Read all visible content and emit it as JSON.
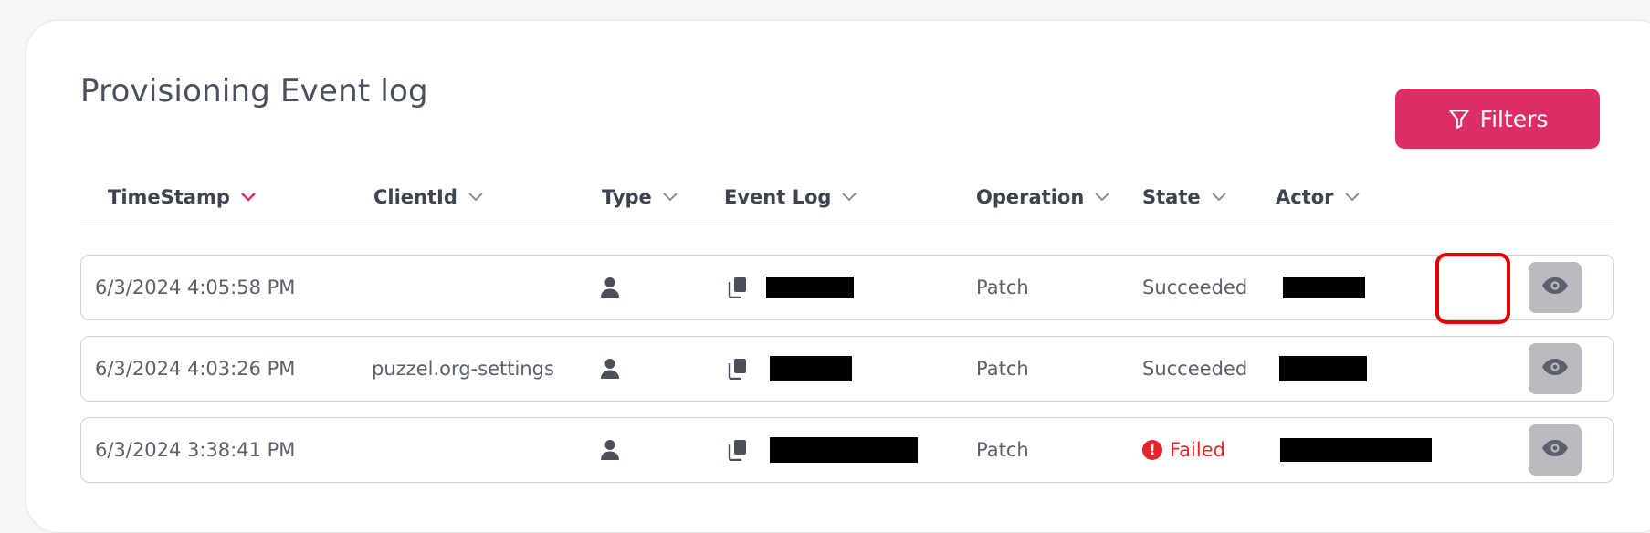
{
  "page": {
    "title": "Provisioning Event log"
  },
  "toolbar": {
    "filters_label": "Filters"
  },
  "columns": {
    "timestamp": "TimeStamp",
    "client_id": "ClientId",
    "type": "Type",
    "event_log": "Event Log",
    "operation": "Operation",
    "state": "State",
    "actor": "Actor"
  },
  "sort": {
    "column": "timestamp",
    "indicator_color": "#dd2e63"
  },
  "rows": [
    {
      "timestamp": "6/3/2024 4:05:58 PM",
      "client_id": "",
      "type_icon": "user-icon",
      "event_log": "[redacted]",
      "operation": "Patch",
      "state": "Succeeded",
      "actor": "[redacted]"
    },
    {
      "timestamp": "6/3/2024 4:03:26 PM",
      "client_id": "puzzel.org-settings",
      "type_icon": "user-icon",
      "event_log": "[redacted]",
      "operation": "Patch",
      "state": "Succeeded",
      "actor": "[redacted]"
    },
    {
      "timestamp": "6/3/2024 3:38:41 PM",
      "client_id": "",
      "type_icon": "user-icon",
      "event_log": "[redacted]",
      "operation": "Patch",
      "state": "Failed",
      "actor": "[redacted]"
    }
  ],
  "colors": {
    "accent": "#dd2e63",
    "failed": "#e5252a",
    "highlight": "#e00000"
  }
}
